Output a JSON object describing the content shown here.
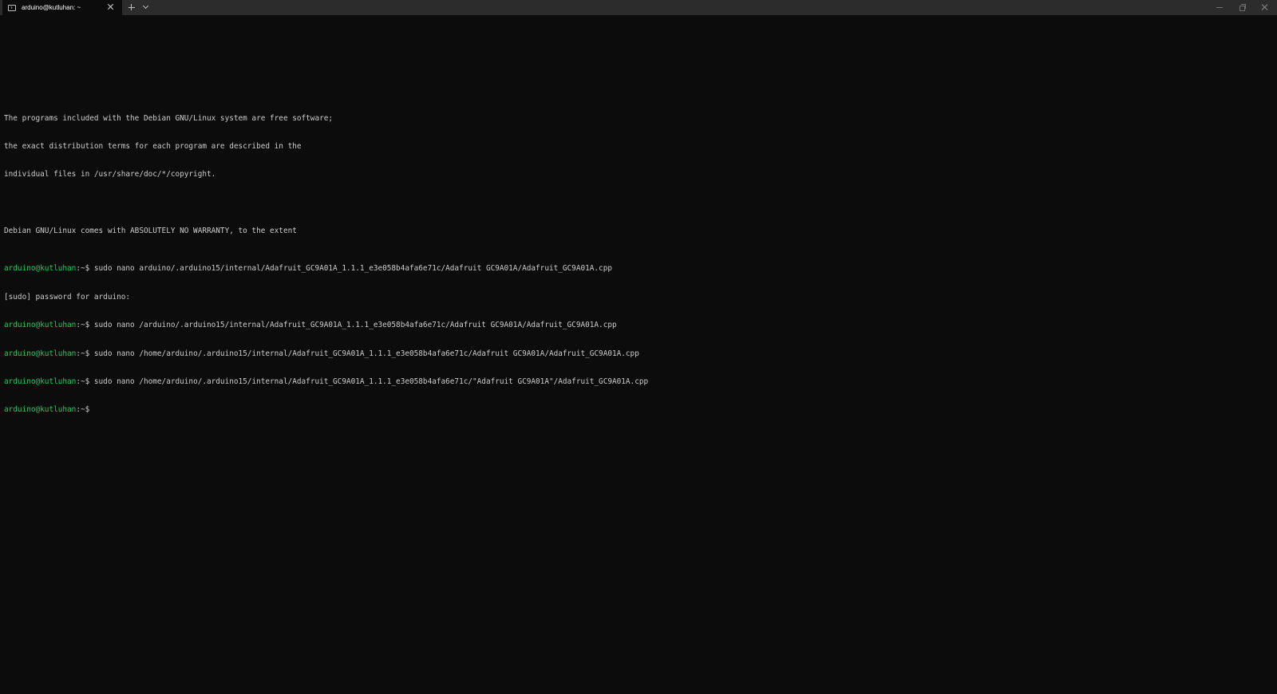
{
  "window": {
    "tab_title": "arduino@kutluhan: ~",
    "icons": {
      "tab": "terminal-icon",
      "tab_close": "close-icon",
      "new_tab": "plus-icon",
      "tab_dropdown": "chevron-down-icon",
      "minimize": "minimize-icon",
      "maximize": "restore-icon",
      "close": "close-icon"
    }
  },
  "colors": {
    "background": "#0c0c0c",
    "titlebar": "#2c2c2c",
    "text": "#cccccc",
    "prompt": "#13d15e"
  },
  "terminal": {
    "intro": [
      "The programs included with the Debian GNU/Linux system are free software;",
      "the exact distribution terms for each program are described in the",
      "individual files in /usr/share/doc/*/copyright.",
      "",
      "Debian GNU/Linux comes with ABSOLUTELY NO WARRANTY, to the extent"
    ],
    "prompt_user": "arduino@kutluhan",
    "prompt_suffix": ":~$",
    "entries": [
      {
        "type": "cmd",
        "text": " sudo nano arduino/.arduino15/internal/Adafruit_GC9A01A_1.1.1_e3e058b4afa6e71c/Adafruit GC9A01A/Adafruit_GC9A01A.cpp"
      },
      {
        "type": "out",
        "text": "[sudo] password for arduino:"
      },
      {
        "type": "cmd",
        "text": " sudo nano /arduino/.arduino15/internal/Adafruit_GC9A01A_1.1.1_e3e058b4afa6e71c/Adafruit GC9A01A/Adafruit_GC9A01A.cpp"
      },
      {
        "type": "cmd",
        "text": " sudo nano /home/arduino/.arduino15/internal/Adafruit_GC9A01A_1.1.1_e3e058b4afa6e71c/Adafruit GC9A01A/Adafruit_GC9A01A.cpp"
      },
      {
        "type": "cmd",
        "text": " sudo nano /home/arduino/.arduino15/internal/Adafruit_GC9A01A_1.1.1_e3e058b4afa6e71c/\"Adafruit GC9A01A\"/Adafruit_GC9A01A.cpp"
      },
      {
        "type": "cmd",
        "text": ""
      }
    ]
  }
}
